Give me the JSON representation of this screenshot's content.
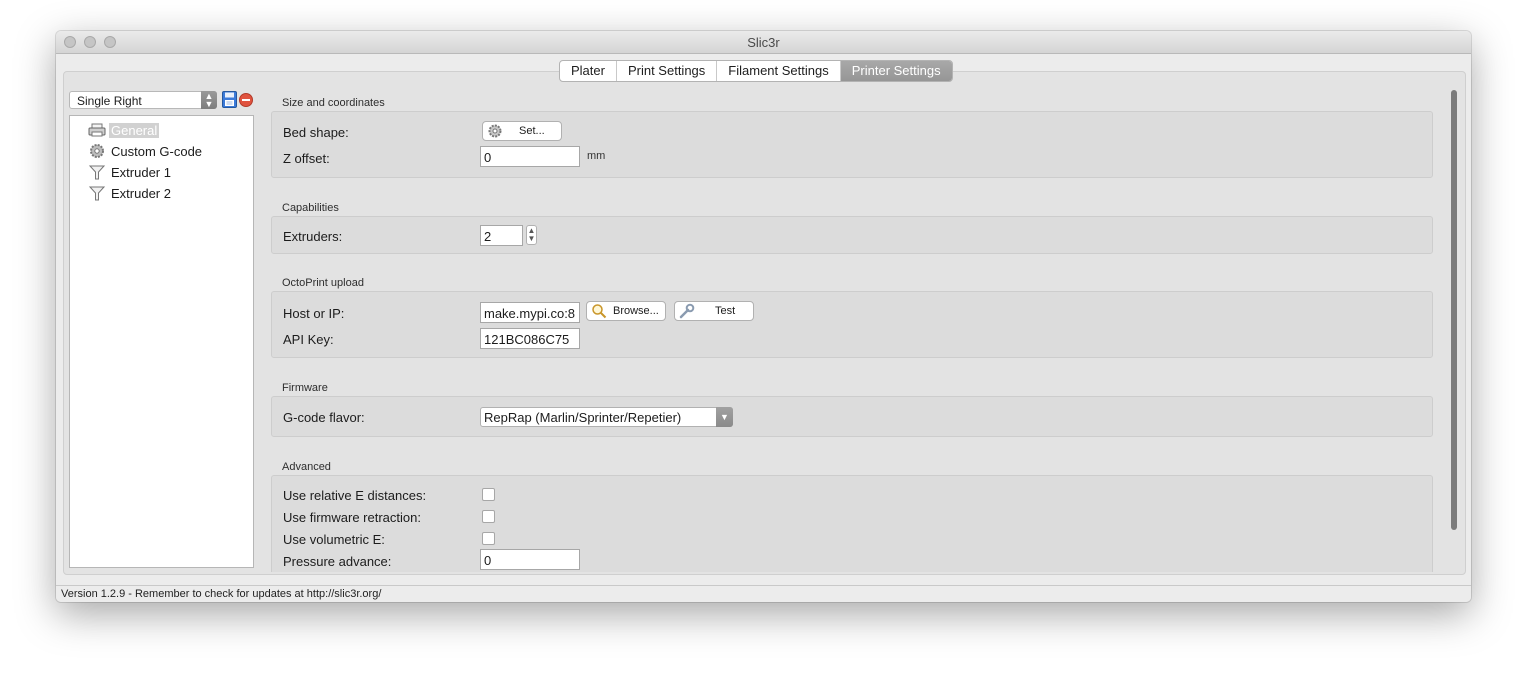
{
  "window": {
    "title": "Slic3r"
  },
  "tabs": [
    {
      "label": "Plater",
      "active": false
    },
    {
      "label": "Print Settings",
      "active": false
    },
    {
      "label": "Filament Settings",
      "active": false
    },
    {
      "label": "Printer Settings",
      "active": true
    }
  ],
  "preset": {
    "selected": "Single Right"
  },
  "tree": [
    {
      "label": "General",
      "icon": "printer-icon",
      "selected": true
    },
    {
      "label": "Custom G-code",
      "icon": "cog-icon",
      "selected": false
    },
    {
      "label": "Extruder 1",
      "icon": "funnel-icon",
      "selected": false
    },
    {
      "label": "Extruder 2",
      "icon": "funnel-icon",
      "selected": false
    }
  ],
  "sections": {
    "size": {
      "title": "Size and coordinates",
      "bed_shape_label": "Bed shape:",
      "bed_shape_button": "Set...",
      "z_offset_label": "Z offset:",
      "z_offset_value": "0",
      "z_offset_unit": "mm"
    },
    "capabilities": {
      "title": "Capabilities",
      "extruders_label": "Extruders:",
      "extruders_value": "2"
    },
    "octoprint": {
      "title": "OctoPrint upload",
      "host_label": "Host or IP:",
      "host_value": "make.mypi.co:8",
      "browse_button": "Browse...",
      "test_button": "Test",
      "api_key_label": "API Key:",
      "api_key_value": "121BC086C75"
    },
    "firmware": {
      "title": "Firmware",
      "gcode_flavor_label": "G-code flavor:",
      "gcode_flavor_value": "RepRap (Marlin/Sprinter/Repetier)"
    },
    "advanced": {
      "title": "Advanced",
      "relative_e_label": "Use relative E distances:",
      "relative_e_checked": false,
      "firmware_retraction_label": "Use firmware retraction:",
      "firmware_retraction_checked": false,
      "volumetric_e_label": "Use volumetric E:",
      "volumetric_e_checked": false,
      "pressure_advance_label": "Pressure advance:",
      "pressure_advance_value": "0"
    }
  },
  "status": {
    "text": "Version 1.2.9 - Remember to check for updates at http://slic3r.org/"
  },
  "colors": {
    "active_tab": "#9f9f9f",
    "delete": "#e0533f",
    "save": "#3b7ad9"
  }
}
